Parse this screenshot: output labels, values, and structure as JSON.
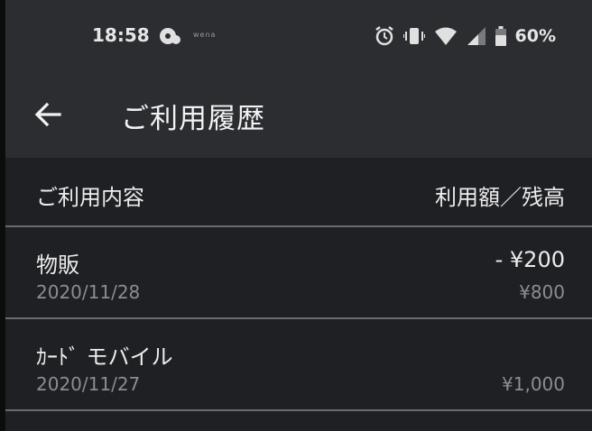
{
  "status_bar": {
    "time": "18:58",
    "app_label": "wena",
    "battery": "60%",
    "icons": [
      "cloud-app-icon",
      "alarm-icon",
      "vibrate-icon",
      "wifi-icon",
      "signal-icon",
      "battery-icon"
    ]
  },
  "app_bar": {
    "back_icon": "arrow-left-icon",
    "title": "ご利用履歴"
  },
  "list_header": {
    "left": "ご利用内容",
    "right": "利用額／残高"
  },
  "transactions": [
    {
      "name": "物販",
      "date": "2020/11/28",
      "amount": "- ¥200",
      "balance": "¥800"
    },
    {
      "name": "ｶｰﾄﾞ モバイル",
      "date": "2020/11/27",
      "amount": "",
      "balance": "¥1,000"
    }
  ],
  "colors": {
    "background": "#1f2024",
    "bar": "#2b2d31",
    "divider": "#6a6b70",
    "text": "#ececec",
    "muted": "#8c8d91"
  }
}
